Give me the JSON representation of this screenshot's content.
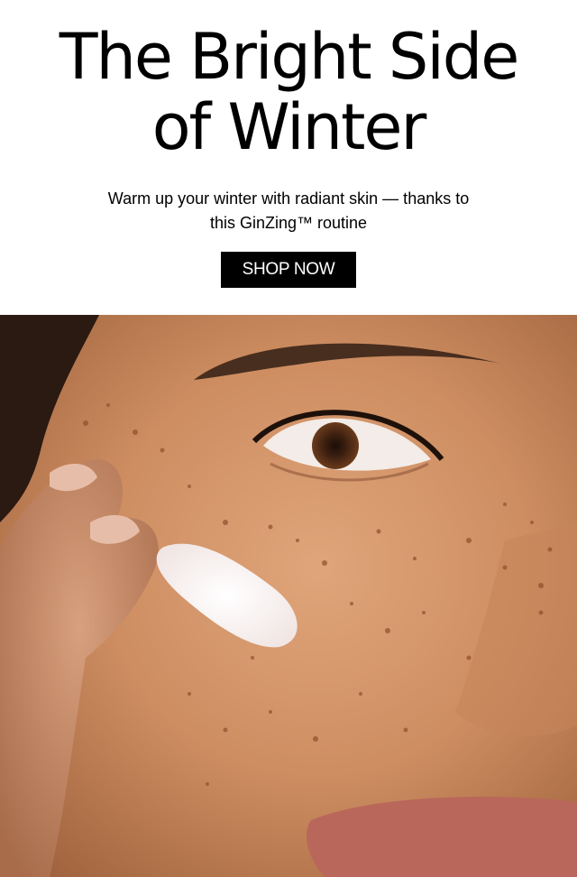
{
  "hero": {
    "headline_line1": "The Bright Side",
    "headline_line2": "of Winter",
    "subtext_line1": "Warm up your winter with radiant skin — thanks to",
    "subtext_line2": "this GinZing™ routine",
    "cta_label": "SHOP NOW"
  },
  "photo": {
    "subject": "close-up-face-applying-moisturizer"
  },
  "colors": {
    "background": "#ffffff",
    "text": "#000000",
    "cta_background": "#000000",
    "cta_text": "#ffffff",
    "skin": "#c98a5e"
  }
}
